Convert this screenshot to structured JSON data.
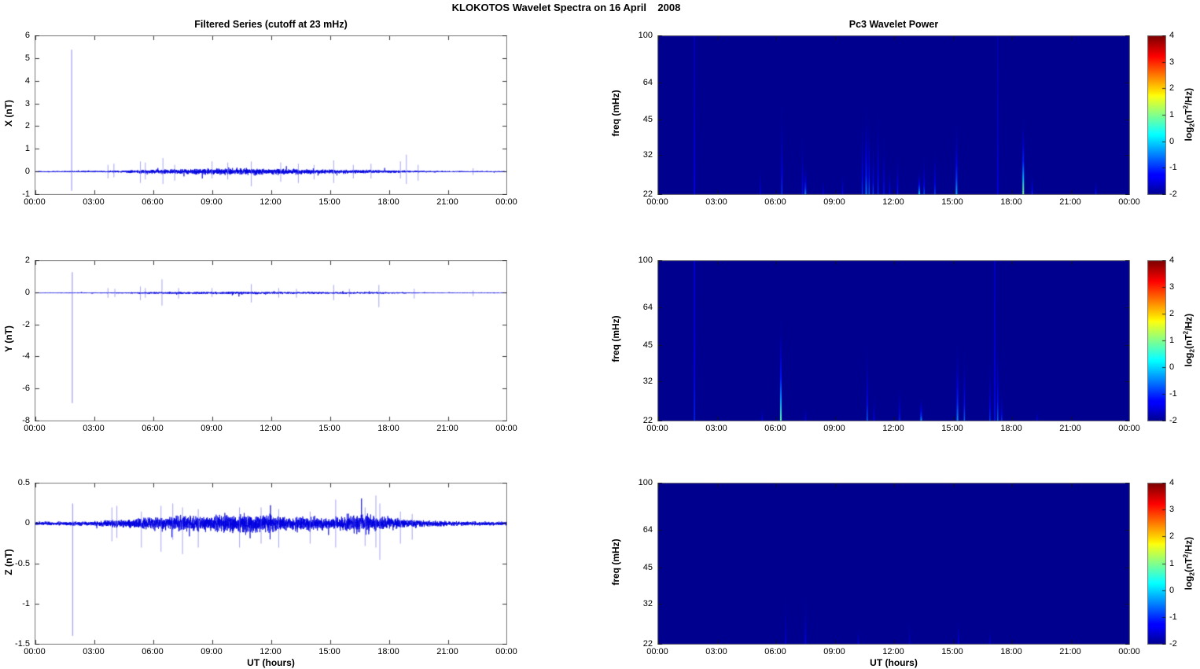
{
  "figure": {
    "title": "KLOKOTOS Wavelet Spectra on 16 April    2008"
  },
  "left_column": {
    "title": "Filtered Series (cutoff at 23 mHz)",
    "xlabel": "UT (hours)"
  },
  "right_column": {
    "title": "Pc3 Wavelet Power",
    "xlabel": "UT (hours)"
  },
  "colorbar_label_parts": {
    "prefix": "log",
    "sub": "2",
    "mid": "(nT",
    "sup": "2",
    "suffix": "/Hz)"
  },
  "colors": {
    "trace_blue": "#0000E0",
    "spike_light_blue": "#6A6AEE",
    "heat_background": "#00008F",
    "axis_box_gray": "#7a7a7a"
  },
  "chart_data": [
    {
      "type": "line",
      "component": "X",
      "title": "Filtered Series (cutoff at 23 mHz)",
      "ylabel": "X (nT)",
      "ylim": [
        -1,
        6
      ],
      "yticks": [
        "6",
        "5",
        "4",
        "3",
        "2",
        "1",
        "0",
        "-1"
      ],
      "xlim_hours": [
        0,
        24
      ],
      "xticks": [
        "00:00",
        "03:00",
        "06:00",
        "09:00",
        "12:00",
        "15:00",
        "18:00",
        "21:00",
        "00:00"
      ],
      "baseline": 0,
      "main_spike": {
        "t": 1.85,
        "up": 5.4,
        "down": -0.85
      },
      "noise_envelope": {
        "t_hours": [
          0,
          1,
          2,
          3,
          4,
          5,
          6,
          7,
          8,
          9,
          10,
          11,
          12,
          13,
          14,
          15,
          16,
          17,
          18,
          19,
          20,
          21,
          22,
          23,
          24
        ],
        "amplitude": [
          0.015,
          0.015,
          0.018,
          0.02,
          0.025,
          0.04,
          0.06,
          0.07,
          0.08,
          0.09,
          0.1,
          0.1,
          0.09,
          0.08,
          0.07,
          0.06,
          0.05,
          0.05,
          0.04,
          0.03,
          0.02,
          0.015,
          0.015,
          0.015,
          0.015
        ]
      },
      "transient_spikes": [
        {
          "t": 3.7,
          "up": 0.3,
          "down": -0.3
        },
        {
          "t": 4.0,
          "up": 0.35,
          "down": -0.25
        },
        {
          "t": 5.35,
          "up": 0.45,
          "down": -0.5
        },
        {
          "t": 5.6,
          "up": 0.4,
          "down": -0.35
        },
        {
          "t": 6.5,
          "up": 0.6,
          "down": -0.55
        },
        {
          "t": 7.1,
          "up": 0.3,
          "down": -0.4
        },
        {
          "t": 9.0,
          "up": 0.45,
          "down": -0.3
        },
        {
          "t": 9.8,
          "up": 0.4,
          "down": -0.35
        },
        {
          "t": 11.0,
          "up": 0.45,
          "down": -0.65
        },
        {
          "t": 12.5,
          "up": 0.4,
          "down": -0.45
        },
        {
          "t": 13.4,
          "up": 0.35,
          "down": -0.5
        },
        {
          "t": 14.2,
          "up": 0.3,
          "down": -0.35
        },
        {
          "t": 15.2,
          "up": 0.5,
          "down": -0.5
        },
        {
          "t": 16.2,
          "up": 0.3,
          "down": -0.3
        },
        {
          "t": 17.1,
          "up": 0.35,
          "down": -0.3
        },
        {
          "t": 18.6,
          "up": 0.45,
          "down": -0.3
        },
        {
          "t": 18.9,
          "up": 0.75,
          "down": -0.55
        },
        {
          "t": 19.5,
          "up": 0.3,
          "down": -0.4
        },
        {
          "t": 22.3,
          "up": 0.15,
          "down": -0.15
        }
      ]
    },
    {
      "type": "line",
      "component": "Y",
      "ylabel": "Y (nT)",
      "ylim": [
        -8,
        2
      ],
      "yticks": [
        "2",
        "0",
        "-2",
        "-4",
        "-6",
        "-8"
      ],
      "xlim_hours": [
        0,
        24
      ],
      "xticks": [
        "00:00",
        "03:00",
        "06:00",
        "09:00",
        "12:00",
        "15:00",
        "18:00",
        "21:00",
        "00:00"
      ],
      "baseline": 0,
      "main_spike": {
        "t": 1.88,
        "up": 1.3,
        "down": -6.9
      },
      "noise_envelope": {
        "t_hours": [
          0,
          1,
          2,
          3,
          4,
          5,
          6,
          7,
          8,
          9,
          10,
          11,
          12,
          13,
          14,
          15,
          16,
          17,
          18,
          19,
          20,
          21,
          22,
          23,
          24
        ],
        "amplitude": [
          0.012,
          0.012,
          0.015,
          0.015,
          0.02,
          0.025,
          0.04,
          0.045,
          0.045,
          0.05,
          0.05,
          0.05,
          0.045,
          0.04,
          0.04,
          0.035,
          0.035,
          0.035,
          0.03,
          0.02,
          0.015,
          0.012,
          0.012,
          0.012,
          0.012
        ]
      },
      "transient_spikes": [
        {
          "t": 3.7,
          "up": 0.3,
          "down": -0.3
        },
        {
          "t": 4.05,
          "up": 0.25,
          "down": -0.25
        },
        {
          "t": 5.35,
          "up": 0.4,
          "down": -0.45
        },
        {
          "t": 5.6,
          "up": 0.3,
          "down": -0.3
        },
        {
          "t": 6.45,
          "up": 0.85,
          "down": -0.8
        },
        {
          "t": 7.3,
          "up": 0.3,
          "down": -0.35
        },
        {
          "t": 9.0,
          "up": 0.3,
          "down": -0.25
        },
        {
          "t": 11.0,
          "up": 0.55,
          "down": -0.6
        },
        {
          "t": 12.4,
          "up": 0.3,
          "down": -0.3
        },
        {
          "t": 13.3,
          "up": 0.25,
          "down": -0.3
        },
        {
          "t": 15.2,
          "up": 0.5,
          "down": -0.45
        },
        {
          "t": 16.0,
          "up": 0.25,
          "down": -0.25
        },
        {
          "t": 17.5,
          "up": 0.5,
          "down": -0.9
        },
        {
          "t": 19.3,
          "up": 0.25,
          "down": -0.35
        },
        {
          "t": 22.3,
          "up": 0.15,
          "down": -0.2
        }
      ]
    },
    {
      "type": "line",
      "component": "Z",
      "ylabel": "Z (nT)",
      "ylim": [
        -1.5,
        0.5
      ],
      "yticks": [
        "0.5",
        "0",
        "-0.5",
        "-1",
        "-1.5"
      ],
      "xlim_hours": [
        0,
        24
      ],
      "xticks": [
        "00:00",
        "03:00",
        "06:00",
        "09:00",
        "12:00",
        "15:00",
        "18:00",
        "21:00",
        "00:00"
      ],
      "baseline": 0,
      "main_spike": {
        "t": 1.9,
        "up": 0.25,
        "down": -1.4
      },
      "noise_envelope": {
        "t_hours": [
          0,
          1,
          2,
          3,
          4,
          5,
          6,
          7,
          8,
          9,
          10,
          11,
          12,
          13,
          14,
          15,
          16,
          17,
          18,
          19,
          20,
          21,
          22,
          23,
          24
        ],
        "amplitude": [
          0.015,
          0.015,
          0.018,
          0.02,
          0.03,
          0.04,
          0.055,
          0.065,
          0.065,
          0.07,
          0.075,
          0.075,
          0.07,
          0.06,
          0.06,
          0.055,
          0.065,
          0.075,
          0.05,
          0.035,
          0.025,
          0.02,
          0.018,
          0.015,
          0.015
        ]
      },
      "transient_spikes": [
        {
          "t": 3.9,
          "up": 0.2,
          "down": -0.22
        },
        {
          "t": 4.15,
          "up": 0.22,
          "down": -0.18
        },
        {
          "t": 5.4,
          "up": 0.15,
          "down": -0.3
        },
        {
          "t": 6.4,
          "up": 0.22,
          "down": -0.35
        },
        {
          "t": 7.0,
          "up": 0.25,
          "down": -0.2
        },
        {
          "t": 7.5,
          "up": 0.2,
          "down": -0.38
        },
        {
          "t": 8.3,
          "up": 0.18,
          "down": -0.3
        },
        {
          "t": 10.4,
          "up": 0.2,
          "down": -0.3
        },
        {
          "t": 11.5,
          "up": 0.2,
          "down": -0.25
        },
        {
          "t": 12.4,
          "up": 0.18,
          "down": -0.3
        },
        {
          "t": 14.0,
          "up": 0.15,
          "down": -0.25
        },
        {
          "t": 15.3,
          "up": 0.3,
          "down": -0.3
        },
        {
          "t": 16.8,
          "up": 0.2,
          "down": -0.28
        },
        {
          "t": 17.35,
          "up": 0.35,
          "down": -0.3
        },
        {
          "t": 17.55,
          "up": 0.25,
          "down": -0.45
        },
        {
          "t": 18.6,
          "up": 0.15,
          "down": -0.25
        },
        {
          "t": 19.2,
          "up": 0.12,
          "down": -0.2
        }
      ]
    },
    {
      "type": "heatmap",
      "component": "X",
      "title": "Pc3 Wavelet Power",
      "ylabel": "freq (mHz)",
      "yscale": "log",
      "ylim_mHz": [
        22,
        100
      ],
      "yticks": [
        "100",
        "64",
        "45",
        "32",
        "22"
      ],
      "xticks": [
        "00:00",
        "03:00",
        "06:00",
        "09:00",
        "12:00",
        "15:00",
        "18:00",
        "21:00",
        "00:00"
      ],
      "background_power_log2": -2,
      "colorbar": {
        "range": [
          -2,
          4
        ],
        "ticks": [
          "4",
          "3",
          "2",
          "1",
          "0",
          "-1",
          "-2"
        ],
        "label": "log2(nT^2/Hz)"
      },
      "streaks": [
        {
          "t": 1.85,
          "fmax": 100,
          "power": -1.2
        },
        {
          "t": 5.2,
          "fmax": 30,
          "power": -1.4
        },
        {
          "t": 6.3,
          "fmax": 62,
          "power": -0.9
        },
        {
          "t": 7.35,
          "fmax": 45,
          "power": -1.2
        },
        {
          "t": 7.5,
          "fmax": 30,
          "power": -0.4
        },
        {
          "t": 8.4,
          "fmax": 26,
          "power": -1.3
        },
        {
          "t": 9.4,
          "fmax": 28,
          "power": -1.2
        },
        {
          "t": 10.4,
          "fmax": 52,
          "power": -0.9
        },
        {
          "t": 10.6,
          "fmax": 55,
          "power": -0.5
        },
        {
          "t": 10.75,
          "fmax": 50,
          "power": -0.6
        },
        {
          "t": 10.95,
          "fmax": 40,
          "power": -0.8
        },
        {
          "t": 11.2,
          "fmax": 57,
          "power": -1.0
        },
        {
          "t": 11.5,
          "fmax": 42,
          "power": -1.1
        },
        {
          "t": 11.8,
          "fmax": 30,
          "power": -1.2
        },
        {
          "t": 12.2,
          "fmax": 35,
          "power": -1.1
        },
        {
          "t": 13.3,
          "fmax": 28,
          "power": 0.0
        },
        {
          "t": 13.55,
          "fmax": 33,
          "power": -0.7
        },
        {
          "t": 14.1,
          "fmax": 36,
          "power": -0.8
        },
        {
          "t": 15.2,
          "fmax": 46,
          "power": -0.2
        },
        {
          "t": 17.3,
          "fmax": 100,
          "power": -1.3
        },
        {
          "t": 18.6,
          "fmax": 48,
          "power": 1.0
        },
        {
          "t": 19.05,
          "fmax": 28,
          "power": -1.0
        },
        {
          "t": 22.3,
          "fmax": 26,
          "power": -1.1
        }
      ]
    },
    {
      "type": "heatmap",
      "component": "Y",
      "ylabel": "freq (mHz)",
      "yscale": "log",
      "ylim_mHz": [
        22,
        100
      ],
      "yticks": [
        "100",
        "64",
        "45",
        "32",
        "22"
      ],
      "xticks": [
        "00:00",
        "03:00",
        "06:00",
        "09:00",
        "12:00",
        "15:00",
        "18:00",
        "21:00",
        "00:00"
      ],
      "background_power_log2": -2,
      "colorbar": {
        "range": [
          -2,
          4
        ],
        "ticks": [
          "4",
          "3",
          "2",
          "1",
          "0",
          "-1",
          "-2"
        ],
        "label": "log2(nT^2/Hz)"
      },
      "streaks": [
        {
          "t": 1.85,
          "fmax": 100,
          "power": -1.0
        },
        {
          "t": 5.3,
          "fmax": 26,
          "power": -1.4
        },
        {
          "t": 6.25,
          "fmax": 60,
          "power": 0.8
        },
        {
          "t": 7.5,
          "fmax": 26,
          "power": -1.4
        },
        {
          "t": 10.65,
          "fmax": 48,
          "power": -0.6
        },
        {
          "t": 11.0,
          "fmax": 30,
          "power": -1.3
        },
        {
          "t": 12.3,
          "fmax": 33,
          "power": -1.0
        },
        {
          "t": 13.4,
          "fmax": 28,
          "power": -0.3
        },
        {
          "t": 15.25,
          "fmax": 50,
          "power": -0.4
        },
        {
          "t": 15.6,
          "fmax": 46,
          "power": -0.6
        },
        {
          "t": 16.9,
          "fmax": 42,
          "power": -0.9
        },
        {
          "t": 17.15,
          "fmax": 100,
          "power": -1.1
        },
        {
          "t": 17.3,
          "fmax": 52,
          "power": -0.6
        },
        {
          "t": 17.5,
          "fmax": 30,
          "power": -0.9
        },
        {
          "t": 19.3,
          "fmax": 25,
          "power": -1.4
        }
      ]
    },
    {
      "type": "heatmap",
      "component": "Z",
      "ylabel": "freq (mHz)",
      "yscale": "log",
      "ylim_mHz": [
        22,
        100
      ],
      "yticks": [
        "100",
        "64",
        "45",
        "32",
        "22"
      ],
      "xticks": [
        "00:00",
        "03:00",
        "06:00",
        "09:00",
        "12:00",
        "15:00",
        "18:00",
        "21:00",
        "00:00"
      ],
      "background_power_log2": -2,
      "colorbar": {
        "range": [
          -2,
          4
        ],
        "ticks": [
          "4",
          "3",
          "2",
          "1",
          "0",
          "-1",
          "-2"
        ],
        "label": "log2(nT^2/Hz)"
      },
      "streaks": [
        {
          "t": 6.5,
          "fmax": 38,
          "power": -1.5
        },
        {
          "t": 7.5,
          "fmax": 38,
          "power": -1.3
        },
        {
          "t": 10.2,
          "fmax": 27,
          "power": -1.5
        },
        {
          "t": 12.8,
          "fmax": 30,
          "power": -1.6
        },
        {
          "t": 15.3,
          "fmax": 29,
          "power": -1.3
        },
        {
          "t": 16.9,
          "fmax": 26,
          "power": -1.5
        }
      ]
    }
  ]
}
